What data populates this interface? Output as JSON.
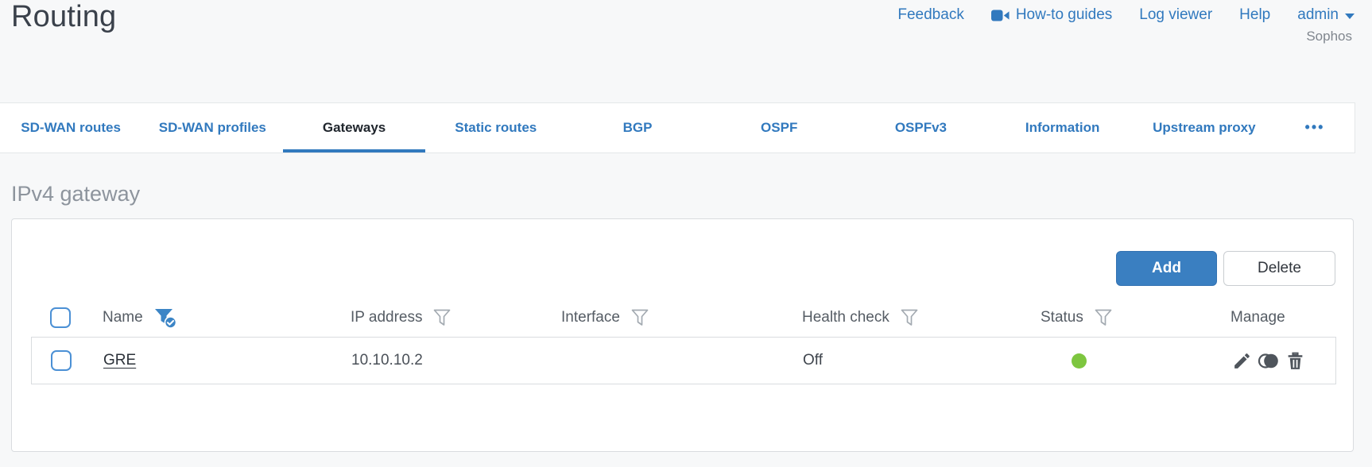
{
  "header": {
    "title": "Routing",
    "brand": "Sophos",
    "nav": [
      {
        "label": "Feedback"
      },
      {
        "label": "How-to guides",
        "icon": "video-camera-icon"
      },
      {
        "label": "Log viewer"
      },
      {
        "label": "Help"
      },
      {
        "label": "admin",
        "icon": "chevron-down-icon"
      }
    ]
  },
  "tabs": [
    {
      "label": "SD-WAN routes",
      "active": false
    },
    {
      "label": "SD-WAN profiles",
      "active": false
    },
    {
      "label": "Gateways",
      "active": true
    },
    {
      "label": "Static routes",
      "active": false
    },
    {
      "label": "BGP",
      "active": false
    },
    {
      "label": "OSPF",
      "active": false
    },
    {
      "label": "OSPFv3",
      "active": false
    },
    {
      "label": "Information",
      "active": false
    },
    {
      "label": "Upstream proxy",
      "active": false
    },
    {
      "label": "•••",
      "active": false,
      "note": "more-tabs overflow menu"
    }
  ],
  "section": {
    "heading": "IPv4 gateway"
  },
  "toolbar": {
    "add_label": "Add",
    "delete_label": "Delete"
  },
  "table": {
    "columns": [
      {
        "label": "Name",
        "filter": "active"
      },
      {
        "label": "IP address",
        "filter": "inactive"
      },
      {
        "label": "Interface",
        "filter": "inactive"
      },
      {
        "label": "Health check",
        "filter": "inactive"
      },
      {
        "label": "Status",
        "filter": "inactive"
      },
      {
        "label": "Manage",
        "filter": "none"
      }
    ],
    "rows": [
      {
        "name": "GRE",
        "ip_address": "10.10.10.2",
        "interface": "",
        "health_check": "Off",
        "status": "up",
        "manage_actions": [
          "edit",
          "deactivate",
          "delete"
        ]
      }
    ]
  },
  "icons": {
    "video-camera-icon": "filled video camera",
    "chevron-down-icon": "▾",
    "filter-icon": "funnel outline",
    "filter-active-icon": "blue funnel with check badge",
    "edit-icon": "pencil",
    "deactivate-icon": "overlapping circles",
    "delete-icon": "trash can"
  },
  "colors": {
    "accent_blue": "#3179be",
    "add_button_blue": "#3a7fc1",
    "status_up_green": "#7dc63f",
    "panel_border": "#d9dcdf",
    "page_background": "#f7f8f9",
    "text_dark": "#2b3139",
    "text_gray": "#555c64",
    "heading_gray": "#8d949d"
  }
}
